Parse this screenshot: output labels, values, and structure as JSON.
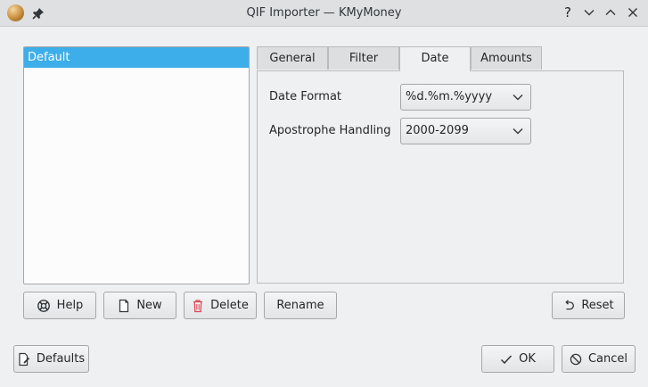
{
  "window": {
    "title": "QIF Importer — KMyMoney"
  },
  "titlebar": {
    "app_icon": "kmymoney-app-icon",
    "pin_icon": "pin-icon",
    "help_glyph": "?",
    "controls": [
      "help-icon",
      "minimize-icon",
      "maximize-icon",
      "close-icon"
    ]
  },
  "profiles": {
    "items": [
      "Default"
    ],
    "selected": "Default"
  },
  "tabs": [
    {
      "label": "General"
    },
    {
      "label": "Filter"
    },
    {
      "label": "Date",
      "active": true
    },
    {
      "label": "Amounts"
    }
  ],
  "date_tab": {
    "date_format": {
      "label": "Date Format",
      "value": "%d.%m.%yyyy"
    },
    "apostrophe": {
      "label": "Apostrophe Handling",
      "value": "2000-2099"
    }
  },
  "buttons": {
    "help": "Help",
    "new": "New",
    "delete": "Delete",
    "rename": "Rename",
    "reset": "Reset",
    "defaults": "Defaults",
    "ok": "OK",
    "cancel": "Cancel"
  },
  "colors": {
    "selection": "#3daee9",
    "background": "#eff0f1",
    "delete_icon": "#da4453"
  }
}
